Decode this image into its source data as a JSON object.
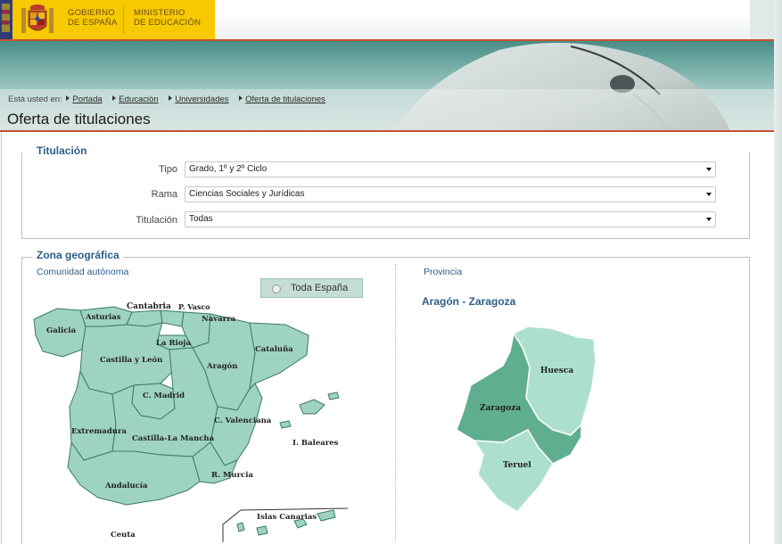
{
  "header": {
    "gov_line1": "GOBIERNO",
    "gov_line2": "DE ESPAÑA",
    "min_line1": "MINISTERIO",
    "min_line2": "DE EDUCACIÓN"
  },
  "breadcrumb": {
    "prefix": "Está usted en:",
    "items": [
      "Portada",
      "Educación",
      "Universidades",
      "Oferta de titulaciones"
    ]
  },
  "page_title": "Oferta de titulaciones",
  "titulacion_section": {
    "legend": "Titulación",
    "fields": [
      {
        "label": "Tipo",
        "value": "Grado, 1º y 2º Ciclo"
      },
      {
        "label": "Rama",
        "value": "Ciencias Sociales y Jurídicas"
      },
      {
        "label": "Titulación",
        "value": "Todas"
      }
    ]
  },
  "zona_section": {
    "legend": "Zona geográfica",
    "comunidad_label": "Comunidad autónoma",
    "provincia_label": "Provincia",
    "toda_espana": "Toda España",
    "selected_province_title": "Aragón - Zaragoza"
  },
  "spain_map": {
    "labels": {
      "cantabria": "Cantabria",
      "pvasco": "P. Vasco",
      "asturias": "Asturias",
      "navarra": "Navarra",
      "galicia": "Galicia",
      "larioja": "La Rioja",
      "cataluna": "Cataluña",
      "castillaleon": "Castilla y León",
      "aragon": "Aragón",
      "madrid": "C. Madrid",
      "valenciana": "C. Valenciana",
      "extremadura": "Extremadura",
      "castillamancha": "Castilla-La Mancha",
      "baleares": "I. Baleares",
      "andalucia": "Andalucía",
      "murcia": "R. Murcia",
      "canarias": "Islas Canarias",
      "ceuta": "Ceuta"
    }
  },
  "province_map": {
    "huesca": "Huesca",
    "zaragoza": "Zaragoza",
    "teruel": "Teruel"
  },
  "colors": {
    "accent_blue": "#2c5e8a",
    "map_fill": "#9ed3c0",
    "selected_fill": "#5fae8f",
    "header_yellow": "#f7c900",
    "banner_teal": "#4a8b85"
  }
}
